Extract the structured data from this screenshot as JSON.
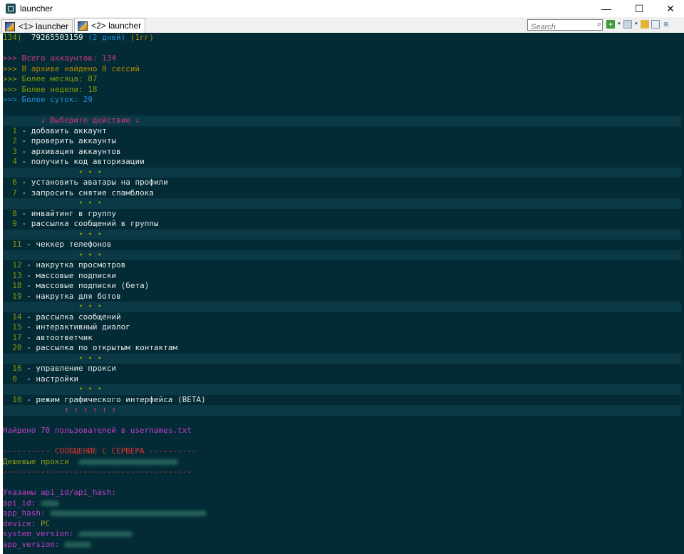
{
  "window": {
    "title": "launcher",
    "minimize_glyph": "—",
    "maximize_glyph": "☐",
    "close_glyph": "✕"
  },
  "tabs": [
    {
      "label": "<1> launcher"
    },
    {
      "label": "<2> launcher"
    }
  ],
  "toolbar": {
    "search_placeholder": "Search",
    "search_glyph": "⌕",
    "add_glyph": "+",
    "dropdown_glyph": "▾",
    "menu_glyph": "≡"
  },
  "console": {
    "top_line": {
      "num": "134)",
      "phone": "79265503159",
      "days": "(2 дней)",
      "extra": "(1гг)"
    },
    "stats": {
      "total": ">>> Всего аккаунтов: 134",
      "archive": ">>> В архиве найдено 0 сессий",
      "month": ">>> Более месяца: 87",
      "week": ">>> Более недели: 18",
      "day": ">>> Более суток: 29"
    },
    "menu_header": "↓ Выберите действие ↓",
    "separator": "• • •",
    "menu_footer": "↑ ↑ ↑ ↑ ↑ ↑",
    "groups": [
      [
        {
          "num": "1",
          "label": "- добавить аккаунт"
        },
        {
          "num": "2",
          "label": "- проверить аккаунты"
        },
        {
          "num": "3",
          "label": "- архивация аккаунтов"
        },
        {
          "num": "4",
          "label": "- получить код авторизации"
        }
      ],
      [
        {
          "num": "6",
          "label": "- установить аватары на профили"
        },
        {
          "num": "7",
          "label": "- запросить снятие спамблока"
        }
      ],
      [
        {
          "num": "8",
          "label": "- инвайтинг в группу"
        },
        {
          "num": "9",
          "label": "- рассылка сообщений в группы"
        }
      ],
      [
        {
          "num": "11",
          "label": "- чеккер телефонов"
        }
      ],
      [
        {
          "num": "12",
          "label": "- накрутка просмотров"
        },
        {
          "num": "13",
          "label": "- массовые подписки"
        },
        {
          "num": "18",
          "label": "- массовые подписки (бета)"
        },
        {
          "num": "19",
          "label": "- накрутка для ботов"
        }
      ],
      [
        {
          "num": "14",
          "label": "- рассылка сообщений"
        },
        {
          "num": "15",
          "label": "- интерактивный диалог"
        },
        {
          "num": "17",
          "label": "- автоответчик"
        },
        {
          "num": "20",
          "label": "- рассылка по открытым контактам"
        }
      ],
      [
        {
          "num": "16",
          "label": "- управление прокси"
        },
        {
          "num": "0",
          "label": "- настройки"
        }
      ],
      [
        {
          "num": "10",
          "label": "- режим графического интерфейса (BETA)"
        }
      ]
    ],
    "found_users": "Найдено 70 пользователей в usernames.txt",
    "server_header": "---------- СООБЩЕНИЕ С СЕРВЕРА ----------",
    "server_message": "Дешевые прокси",
    "server_rule": "----------------------------------------",
    "api_header": "Указаны api_id/api_hash:",
    "api_fields": [
      {
        "key": "api_id:"
      },
      {
        "key": "app_hash:"
      },
      {
        "key": "device:",
        "value": "PC"
      },
      {
        "key": "system_version:"
      },
      {
        "key": "app_version:"
      }
    ]
  }
}
